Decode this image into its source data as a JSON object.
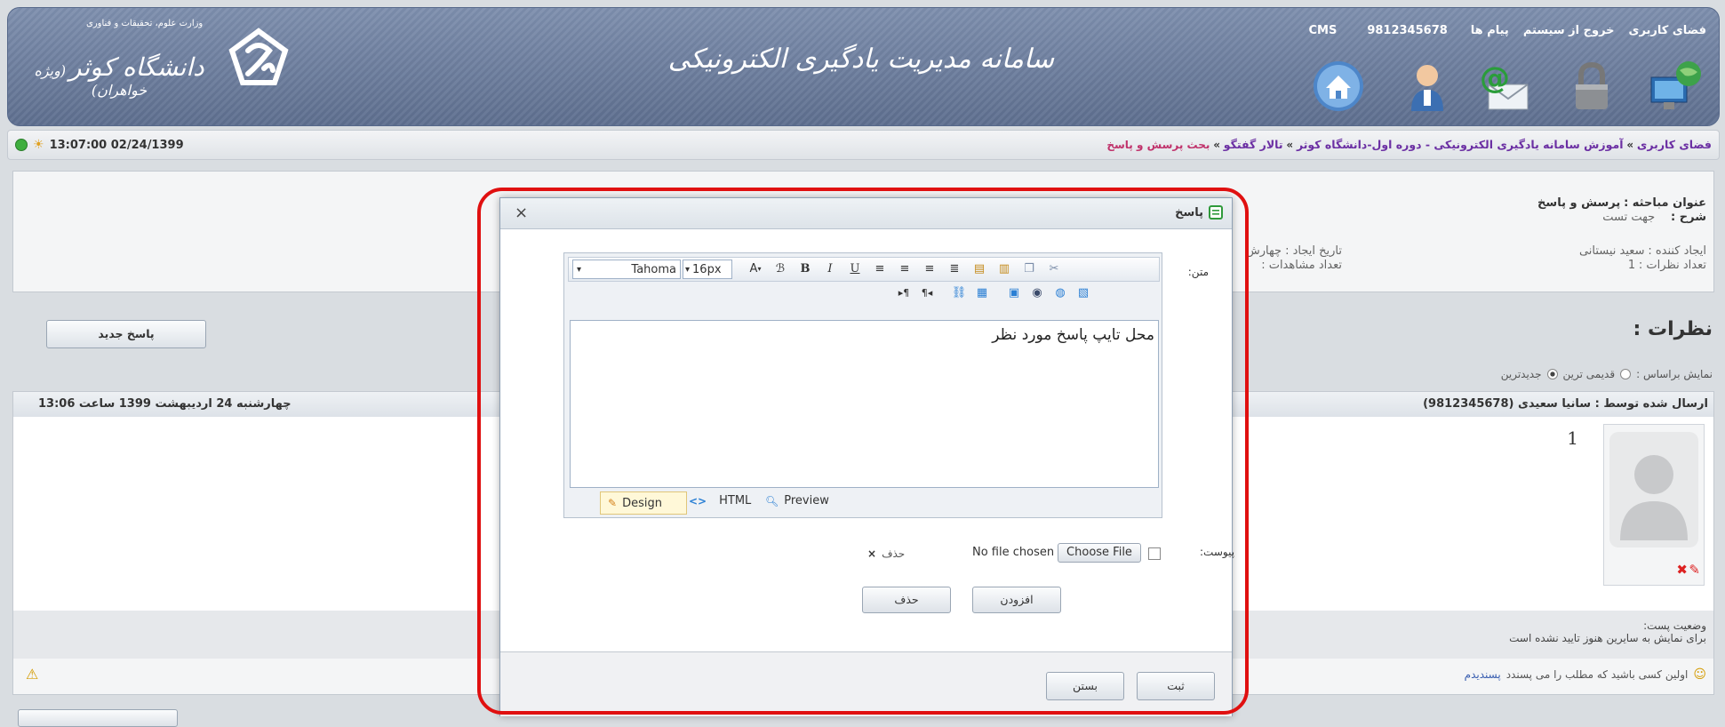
{
  "header": {
    "ministry": "وزارت علوم، تحقیقات و فناوری",
    "university": "دانشگاه کوثر",
    "university_sub": "(ویژه خواهران)",
    "system_title": "سامانه مدیریت یادگیری الکترونیکی",
    "links": {
      "user_space": "فضای کاربری",
      "logout": "خروج از سیستم",
      "messages": "پیام ها",
      "user_id": "9812345678",
      "cms": "CMS"
    }
  },
  "breadcrumb": {
    "items": [
      "فضای کاربری",
      "آموزش سامانه یادگیری الکترونیکی - دوره اول-دانشگاه کوثر",
      "تالار گفتگو"
    ],
    "current": "بحث پرسش و پاسخ",
    "sep": "»",
    "datetime": "13:07:00 02/24/1399"
  },
  "discussion": {
    "title_label": "عنوان مباحثه :",
    "title_value": "پرسش و پاسخ",
    "desc_label": "شرح :",
    "desc_value": "جهت تست",
    "creator_label": "ایجاد کننده :",
    "creator_value": "سعید نیستانی",
    "comments_count_label": "تعداد نظرات :",
    "comments_count_value": "1",
    "created_label": "تاریخ ایجاد : چهارش",
    "views_label": "تعداد مشاهدات :"
  },
  "comments": {
    "heading": "نظرات :",
    "new_reply": "پاسخ جدید",
    "sort_label": "نمایش براساس :",
    "sort_options": [
      "قدیمی ترین",
      "جدیدترین"
    ],
    "post_by": "ارسال شده توسط : سانیا سعیدی (9812345678)",
    "post_date": "چهارشنبه 24 اردیبهشت 1399 ساعت 13:06",
    "post_body": "1",
    "status_label": "وضعیت پست:",
    "status_text": "برای نمایش به سایرین هنوز تایید نشده است",
    "like_prefix": "اولین کسی باشید که مطلب را می پسندد",
    "like_link": "پسندیدم"
  },
  "modal": {
    "title": "پاسخ",
    "text_label": "متن:",
    "font_family": "Tahoma",
    "font_size": "16px",
    "editor_content": "محل تایپ پاسخ مورد نظر",
    "modes": [
      "Design",
      "HTML",
      "Preview"
    ],
    "attach_label": "پیوست:",
    "file_button": "Choose File",
    "file_status": "No file chosen",
    "delete_link": "حذف",
    "add_button": "افزودن",
    "remove_button": "حذف",
    "submit_button": "ثبت",
    "close_button": "بستن",
    "close_x": "×"
  },
  "colors": {
    "header_bg": "#6b7c9c",
    "crumb_link": "#6b2fa3",
    "crumb_current": "#c0326b",
    "ring": "#e01010"
  }
}
